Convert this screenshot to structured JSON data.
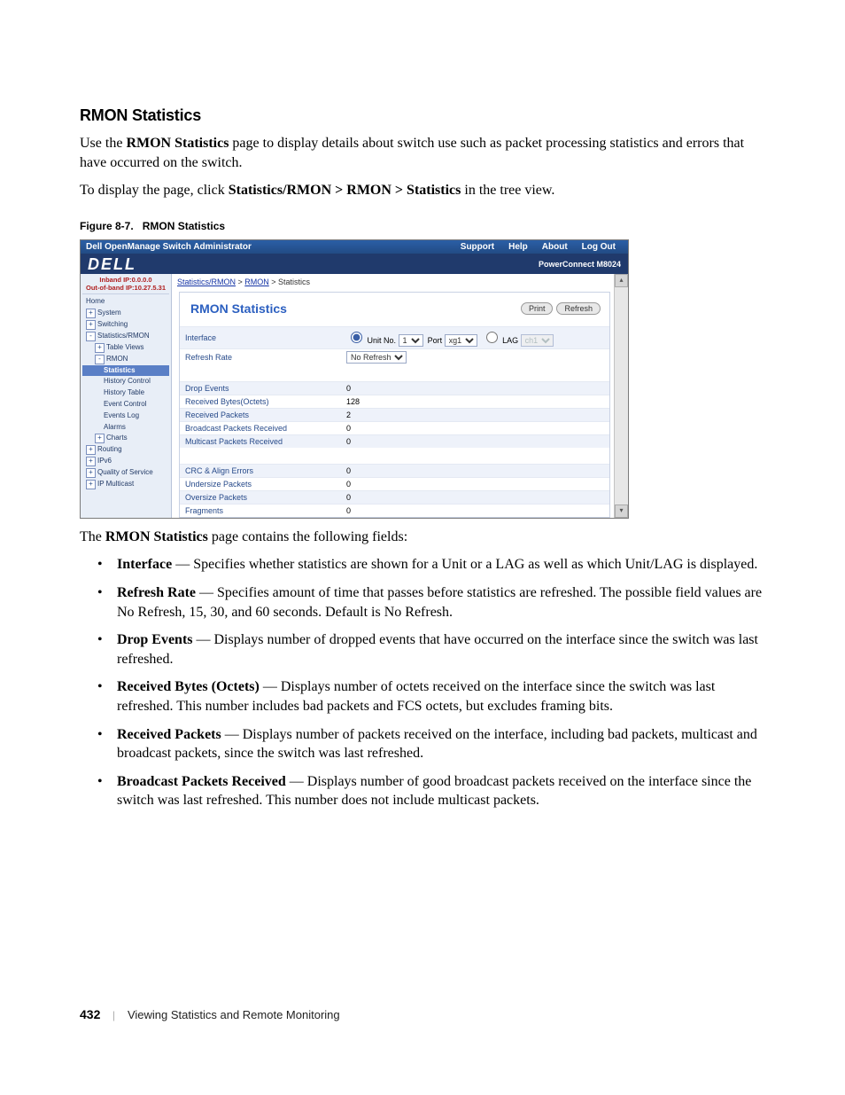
{
  "heading": "RMON Statistics",
  "intro1_a": "Use the ",
  "intro1_bold": "RMON Statistics",
  "intro1_b": " page to display details about switch use such as packet processing statistics and errors that have occurred on the switch.",
  "intro2_a": "To display the page, click ",
  "intro2_bold": "Statistics/RMON > RMON > Statistics",
  "intro2_b": " in the tree view.",
  "figcap_label": "Figure 8-7.",
  "figcap_title": "RMON Statistics",
  "screenshot": {
    "window_title": "Dell OpenManage Switch Administrator",
    "toplinks": [
      "Support",
      "Help",
      "About",
      "Log Out"
    ],
    "logo": "DELL",
    "model": "PowerConnect M8024",
    "ip_inband": "Inband IP:0.0.0.0",
    "ip_outband": "Out-of-band IP:10.27.5.31",
    "breadcrumbs": {
      "a": "Statistics/RMON",
      "b": "RMON",
      "c": "Statistics"
    },
    "panel_title": "RMON Statistics",
    "btn_print": "Print",
    "btn_refresh": "Refresh",
    "tree": [
      {
        "lvl": 1,
        "glyph": "",
        "label": "Home"
      },
      {
        "lvl": 1,
        "glyph": "+",
        "label": "System"
      },
      {
        "lvl": 1,
        "glyph": "+",
        "label": "Switching"
      },
      {
        "lvl": 1,
        "glyph": "-",
        "label": "Statistics/RMON"
      },
      {
        "lvl": 2,
        "glyph": "+",
        "label": "Table Views"
      },
      {
        "lvl": 2,
        "glyph": "-",
        "label": "RMON"
      },
      {
        "lvl": 3,
        "glyph": "",
        "label": "Statistics",
        "selected": true
      },
      {
        "lvl": 3,
        "glyph": "",
        "label": "History Control"
      },
      {
        "lvl": 3,
        "glyph": "",
        "label": "History Table"
      },
      {
        "lvl": 3,
        "glyph": "",
        "label": "Event Control"
      },
      {
        "lvl": 3,
        "glyph": "",
        "label": "Events Log"
      },
      {
        "lvl": 3,
        "glyph": "",
        "label": "Alarms"
      },
      {
        "lvl": 2,
        "glyph": "+",
        "label": "Charts"
      },
      {
        "lvl": 1,
        "glyph": "+",
        "label": "Routing"
      },
      {
        "lvl": 1,
        "glyph": "+",
        "label": "IPv6"
      },
      {
        "lvl": 1,
        "glyph": "+",
        "label": "Quality of Service"
      },
      {
        "lvl": 1,
        "glyph": "+",
        "label": "IP Multicast"
      }
    ],
    "row_interface": "Interface",
    "row_unit_label": "Unit No.",
    "row_unit_value": "1",
    "row_port_label": "Port",
    "row_port_value": "xg1",
    "row_lag_label": "LAG",
    "row_lag_value": "ch1",
    "row_refresh_label": "Refresh Rate",
    "row_refresh_value": "No Refresh",
    "stats": [
      {
        "label": "Drop Events",
        "value": "0"
      },
      {
        "label": "Received Bytes(Octets)",
        "value": "128"
      },
      {
        "label": "Received Packets",
        "value": "2"
      },
      {
        "label": "Broadcast Packets Received",
        "value": "0"
      },
      {
        "label": "Multicast Packets Received",
        "value": "0"
      }
    ],
    "errs": [
      {
        "label": "CRC & Align Errors",
        "value": "0"
      },
      {
        "label": "Undersize Packets",
        "value": "0"
      },
      {
        "label": "Oversize Packets",
        "value": "0"
      },
      {
        "label": "Fragments",
        "value": "0"
      }
    ]
  },
  "after_fig_a": "The ",
  "after_fig_bold": "RMON Statistics",
  "after_fig_b": " page contains the following fields:",
  "fields": [
    {
      "name": "Interface",
      "desc": " — Specifies whether statistics are shown for a Unit or a LAG as well as which Unit/LAG is displayed."
    },
    {
      "name": "Refresh Rate",
      "desc": " — Specifies amount of time that passes before statistics are refreshed. The possible field values are No Refresh, 15, 30, and 60 seconds. Default is No Refresh."
    },
    {
      "name": "Drop Events",
      "desc": " — Displays number of dropped events that have occurred on the interface since the switch was last refreshed."
    },
    {
      "name": "Received Bytes (Octets)",
      "desc": " — Displays number of octets received on the interface since the switch was last refreshed. This number includes bad packets and FCS octets, but excludes framing bits."
    },
    {
      "name": "Received Packets",
      "desc": " — Displays number of packets received on the interface, including bad packets, multicast and broadcast packets, since the switch was last refreshed."
    },
    {
      "name": "Broadcast Packets Received",
      "desc": " — Displays number of good broadcast packets received on the interface since the switch was last refreshed. This number does not include multicast packets."
    }
  ],
  "footer_page": "432",
  "footer_section": "Viewing Statistics and Remote Monitoring"
}
